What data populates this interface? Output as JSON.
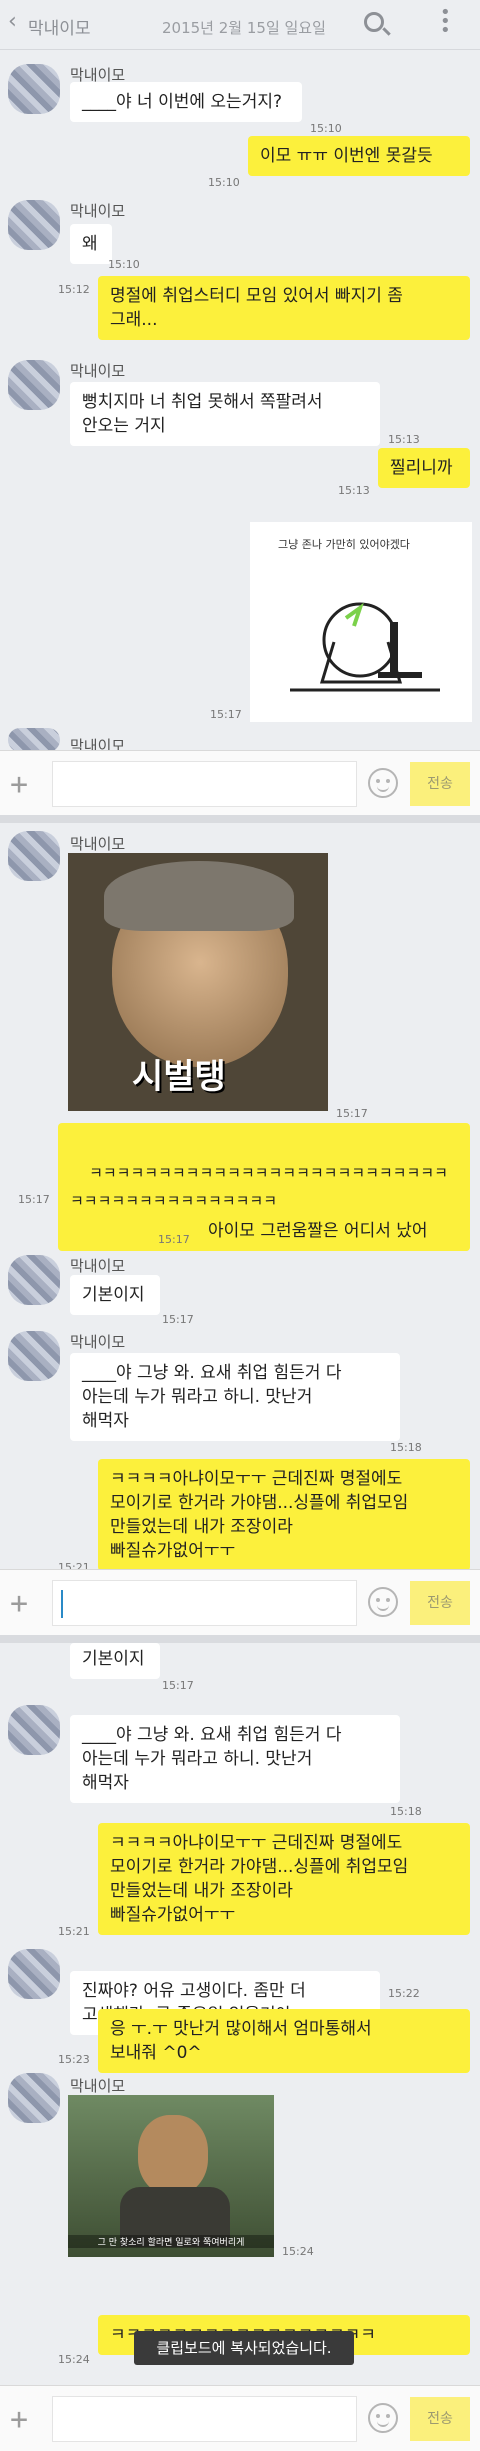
{
  "header": {
    "back_icon": "chevron-left-icon",
    "chat_name": "막내이모",
    "date": "2015년 2월 15일 일요일"
  },
  "input": {
    "send_label": "전송"
  },
  "panel1": {
    "msgs": [
      {
        "from": "in",
        "sender": "막내이모",
        "text": "____야 너 이번에 오는거지?",
        "time": "15:10"
      },
      {
        "from": "out",
        "text": "이모 ㅠㅠ 이번엔 못갈듯",
        "time": "15:10"
      },
      {
        "from": "in",
        "sender": "막내이모",
        "text": "왜",
        "time": "15:10"
      },
      {
        "from": "out",
        "text": "명절에 취업스터디 모임 있어서 빠지기 좀\n그래...",
        "time": "15:12"
      },
      {
        "from": "in",
        "sender": "막내이모",
        "text": "뻥치지마 너 취업 못해서 쪽팔려서\n안오는 거지",
        "time": "15:13"
      },
      {
        "from": "out",
        "text": "찔리니까",
        "time": "15:13"
      },
      {
        "from": "out-img",
        "caption": "그냥 존나 가만히 있어야겠다",
        "time": "15:17"
      },
      {
        "from": "in-cut",
        "sender": "막내이모"
      }
    ]
  },
  "panel2": {
    "msgs": [
      {
        "from": "in-img",
        "sender": "막내이모",
        "caption": "시벌탱",
        "time": "15:17"
      },
      {
        "from": "out",
        "text": "ㅋㅋㅋㅋㅋㅋㅋㅋㅋㅋㅋㅋㅋㅋㅋㅋㅋㅋㅋㅋㅋㅋㅋㅋㅋㅋㅋㅋㅋㅋㅋㅋㅋㅋㅋㅋㅋㅋㅋㅋㅋ",
        "time": "15:17"
      },
      {
        "from": "out",
        "text": "아이모 그런움짤은 어디서 났어",
        "time": "15:17"
      },
      {
        "from": "in",
        "sender": "막내이모",
        "text": "기본이지",
        "time": "15:17"
      },
      {
        "from": "in",
        "sender": "막내이모",
        "text": "____야 그냥 와. 요새 취업 힘든거 다\n아는데 누가 뭐라고 하니. 맛난거\n해먹자",
        "time": "15:18"
      },
      {
        "from": "out",
        "text": "ㅋㅋㅋㅋ아냐이모ㅜㅜ 근데진짜 명절에도\n모이기로 한거라 가야댐...싱플에 취업모임\n만들었는데 내가 조장이라\n빠질슈가없어ㅜㅜ",
        "time": "15:21"
      }
    ]
  },
  "panel3": {
    "msgs": [
      {
        "from": "in-cut",
        "text": "기본이지",
        "time": "15:17"
      },
      {
        "from": "in",
        "sender": "",
        "text": "____야 그냥 와. 요새 취업 힘든거 다\n아는데 누가 뭐라고 하니. 맛난거\n해먹자",
        "time": "15:18"
      },
      {
        "from": "out",
        "text": "ㅋㅋㅋㅋ아냐이모ㅜㅜ 근데진짜 명절에도\n모이기로 한거라 가야댐...싱플에 취업모임\n만들었는데 내가 조장이라\n빠질슈가없어ㅜㅜ",
        "time": "15:21"
      },
      {
        "from": "in",
        "sender": "",
        "text": "진짜야? 어유 고생이다. 좀만 더\n고생해라. 곧 좋은일 있을거야",
        "time": "15:22"
      },
      {
        "from": "out",
        "text": "응 ㅜ.ㅜ 맛난거 많이해서 엄마통해서\n보내줘 ^0^",
        "time": "15:23"
      },
      {
        "from": "in-img",
        "sender": "막내이모",
        "caption": "그 만 찾소리 할라면 일로와 쭉여버리게",
        "time": "15:24"
      },
      {
        "from": "out",
        "text": "ㅋㅋㅋㅋㅋㅋㅋㅋㅋㅋㅋㅋㅋㅋㅋㅋㅋ",
        "time": "15:24"
      }
    ],
    "toast": "클립보드에 복사되었습니다."
  }
}
